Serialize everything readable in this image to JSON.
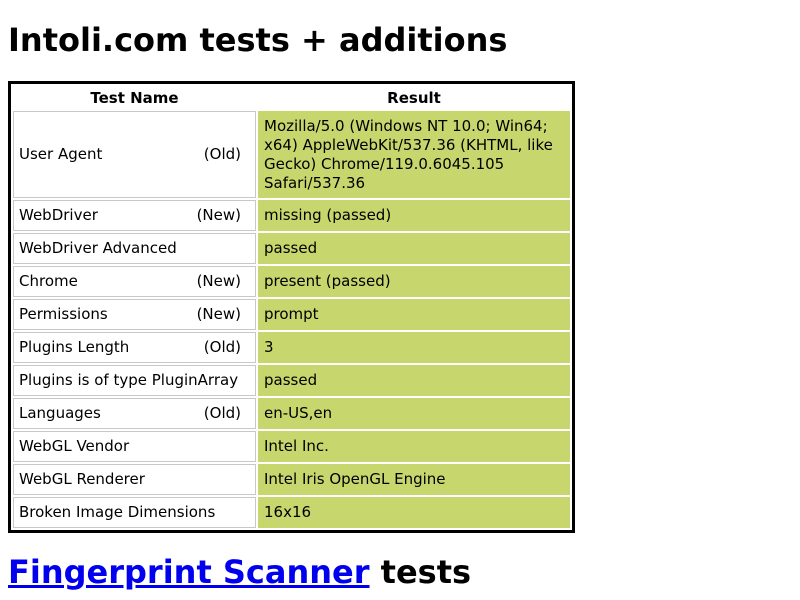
{
  "page_title": "Intoli.com tests + additions",
  "table": {
    "headers": {
      "name": "Test Name",
      "result": "Result"
    },
    "rows": [
      {
        "name": "User Agent",
        "tag": "(Old)",
        "result": "Mozilla/5.0 (Windows NT 10.0; Win64; x64) AppleWebKit/537.36 (KHTML, like Gecko) Chrome/119.0.6045.105 Safari/537.36"
      },
      {
        "name": "WebDriver",
        "tag": "(New)",
        "result": "missing (passed)"
      },
      {
        "name": "WebDriver Advanced",
        "tag": "",
        "result": "passed"
      },
      {
        "name": "Chrome",
        "tag": "(New)",
        "result": "present (passed)"
      },
      {
        "name": "Permissions",
        "tag": "(New)",
        "result": "prompt"
      },
      {
        "name": "Plugins Length",
        "tag": "(Old)",
        "result": "3"
      },
      {
        "name": "Plugins is of type PluginArray",
        "tag": "",
        "result": "passed"
      },
      {
        "name": "Languages",
        "tag": "(Old)",
        "result": "en-US,en"
      },
      {
        "name": "WebGL Vendor",
        "tag": "",
        "result": "Intel Inc."
      },
      {
        "name": "WebGL Renderer",
        "tag": "",
        "result": "Intel Iris OpenGL Engine"
      },
      {
        "name": "Broken Image Dimensions",
        "tag": "",
        "result": "16x16"
      }
    ]
  },
  "fingerprint": {
    "link_text": "Fingerprint Scanner",
    "suffix": " tests"
  },
  "colors": {
    "pass_background": "#c8d66e",
    "link": "#0000ee"
  }
}
